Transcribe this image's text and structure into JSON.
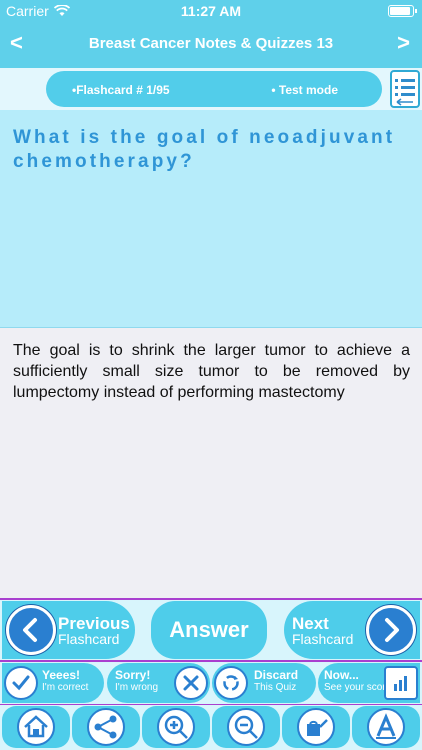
{
  "status_bar": {
    "carrier": "Carrier",
    "time": "11:27 AM"
  },
  "nav": {
    "title": "Breast Cancer Notes & Quizzes 13",
    "back": "<",
    "forward": ">"
  },
  "subheader": {
    "flashcard_number": "•Flashcard #  1/95",
    "mode": "• Test mode"
  },
  "question": {
    "text": "What is the goal of neoadjuvant chemotherapy?"
  },
  "answer": {
    "text": "The goal is to shrink the larger tumor to achieve a sufficiently small size tumor to be removed by lumpectomy instead of performing mastectomy"
  },
  "controls": {
    "previous": {
      "title": "Previous",
      "subtitle": "Flashcard"
    },
    "answer": "Answer",
    "next": {
      "title": "Next",
      "subtitle": "Flashcard"
    },
    "marks": [
      {
        "title": "Yeees!",
        "subtitle": "I'm correct",
        "icon": "check-icon"
      },
      {
        "title": "Sorry!",
        "subtitle": "I'm wrong",
        "icon": "x-icon"
      },
      {
        "title": "Discard",
        "subtitle": "This Quiz",
        "icon": "recycle-icon"
      },
      {
        "title": "Now...",
        "subtitle": "See your score",
        "icon": "bar-chart-icon"
      }
    ],
    "tools": [
      "home-icon",
      "share-icon",
      "zoom-in-icon",
      "zoom-out-icon",
      "watering-can-icon",
      "font-icon"
    ]
  },
  "colors": {
    "primary": "#5fd0ea",
    "question_bg": "#b6ecfa",
    "question_text": "#2f95d6",
    "accent_blue": "#2a7fd0",
    "divider_purple": "#a93fcf"
  }
}
